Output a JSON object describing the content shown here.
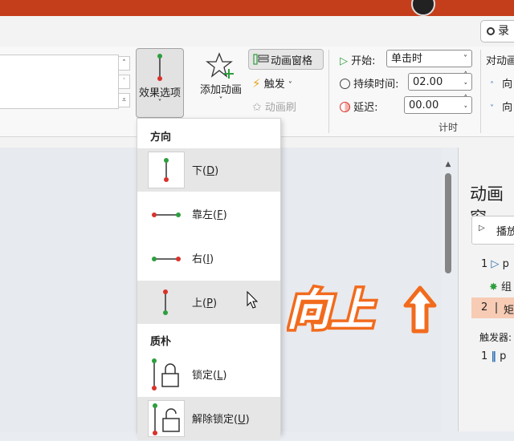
{
  "window": {
    "record_label": "录"
  },
  "ribbon": {
    "effect_options_label": "效果选项",
    "add_animation_label": "添加动画",
    "animation_pane_label": "动画窗格",
    "trigger_label": "触发",
    "animation_painter_label": "动画刷",
    "start_label": "开始:",
    "start_value": "单击时",
    "duration_label": "持续时间:",
    "duration_value": "02.00",
    "delay_label": "延迟:",
    "delay_value": "00.00",
    "timing_group_label": "计时",
    "reorder_label": "对动画",
    "move_earlier": "向",
    "move_later": "向"
  },
  "menu": {
    "direction_header": "方向",
    "style_header": "质朴",
    "items": [
      {
        "label": "下",
        "key": "D",
        "icon": "line-vertical-down-icon"
      },
      {
        "label": "靠左",
        "key": "F",
        "icon": "line-horizontal-left-icon"
      },
      {
        "label": "右",
        "key": "I",
        "icon": "line-horizontal-right-icon"
      },
      {
        "label": "上",
        "key": "P",
        "icon": "line-vertical-up-icon"
      },
      {
        "label": "锁定",
        "key": "L",
        "icon": "lock-icon"
      },
      {
        "label": "解除锁定",
        "key": "U",
        "icon": "unlock-icon"
      }
    ]
  },
  "overlay": {
    "big_text": "向上"
  },
  "pane": {
    "title": "动画窗",
    "play_label": "播放",
    "rows": [
      {
        "num": "1",
        "text": "p"
      },
      {
        "num": "",
        "text": "组"
      },
      {
        "num": "2",
        "text": "矩"
      }
    ],
    "trigger_header": "触发器:",
    "trigger_row": {
      "num": "1",
      "text": "p"
    }
  },
  "colors": {
    "accent": "#c43e1c",
    "overlay_orange": "#f26b1d",
    "green_dot": "#2e9e3e",
    "red_dot": "#d9322b"
  }
}
